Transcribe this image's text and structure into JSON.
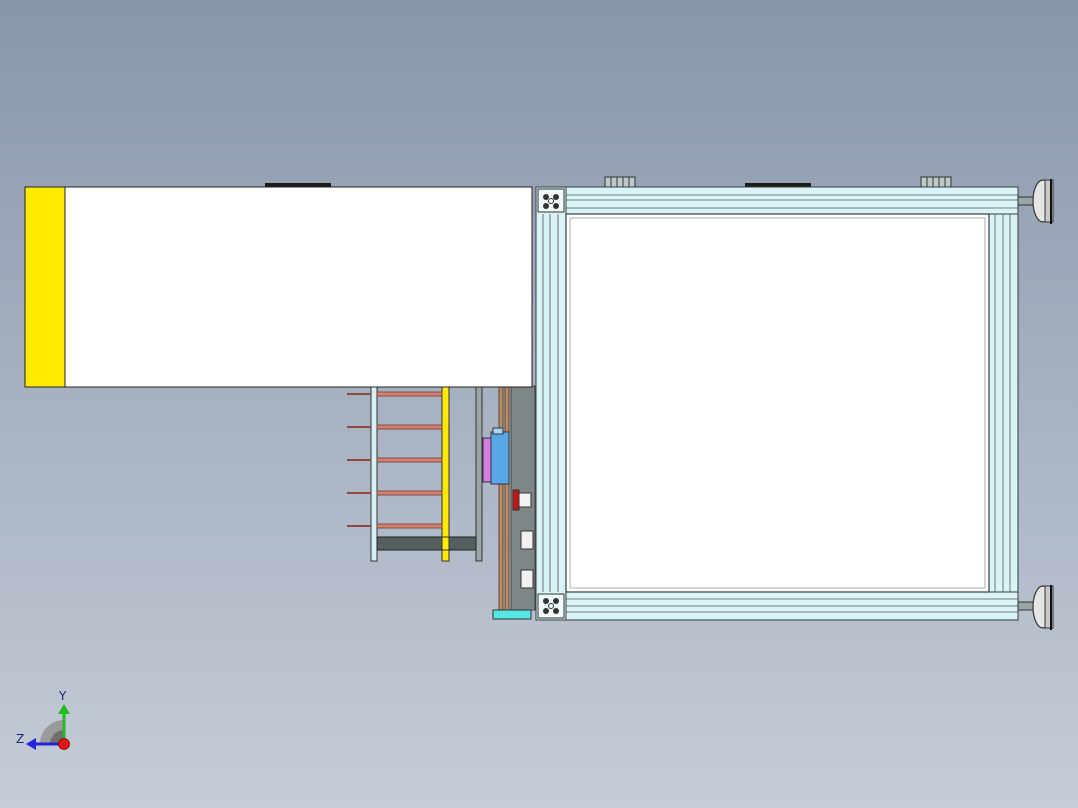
{
  "triad": {
    "y_label": "Y",
    "z_label": "Z"
  },
  "colors": {
    "background_top": "#8797ab",
    "background_bottom": "#c6ccd8",
    "cover_panel": "#ffffff",
    "yellow_band": "#ffea00",
    "frame_profile": "#d8f4f6",
    "frame_outline": "#3a3a3a",
    "rod": "#d7806f",
    "dark_shaft": "#54605f",
    "magenta_block": "#d27be0",
    "blue_block": "#58a8e8",
    "red_knob": "#c41616",
    "cyan_plate": "#56e6e6",
    "axis_y": "#22bb22",
    "axis_z": "#2222dd",
    "axis_x": "#e01818"
  },
  "model": {
    "icons": [
      "cover-panel",
      "aluminum-frame",
      "foot-leveler",
      "rod-rack",
      "axis-triad"
    ]
  }
}
